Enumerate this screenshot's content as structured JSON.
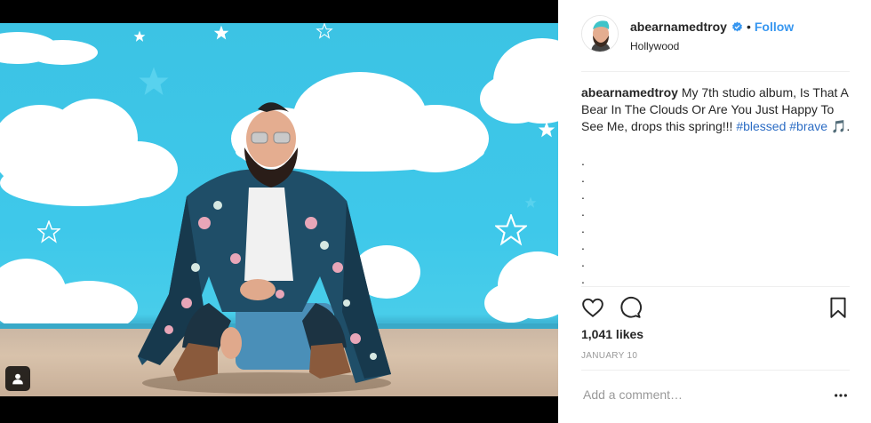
{
  "post": {
    "username": "abearnamedtroy",
    "follow_label": "Follow",
    "location": "Hollywood",
    "caption": {
      "username": "abearnamedtroy",
      "text": "My 7th studio album, Is That A Bear In The Clouds Or Are You Just Happy To See Me, drops this spring!!!",
      "hashtags": [
        "#blessed",
        "#brave"
      ],
      "emoji": "🎵",
      "end": ".",
      "dot_lines": [
        ".",
        ".",
        ".",
        ".",
        ".",
        ".",
        ".",
        "."
      ]
    },
    "likes": "1,041 likes",
    "date": "JANUARY 10",
    "comment_placeholder": "Add a comment…"
  },
  "icons": {
    "verified": "verified-badge-icon",
    "like": "heart-icon",
    "comment": "comment-bubble-icon",
    "save": "bookmark-icon",
    "more": "more-dots-icon",
    "user_tag": "user-tag-icon"
  },
  "colors": {
    "link_blue": "#3897f0",
    "hashtag": "#2b6cc4",
    "sky": "#3cc3e4",
    "meta_gray": "#999999"
  }
}
